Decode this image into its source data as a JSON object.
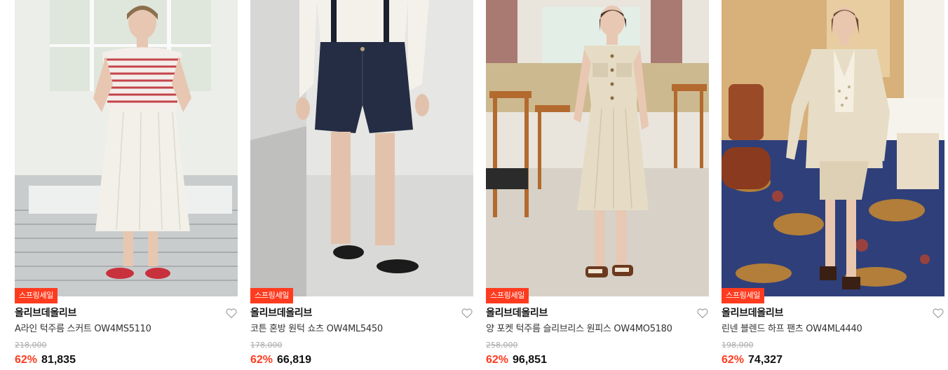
{
  "products": [
    {
      "badge": "스프링세일",
      "brand": "올리브데올리브",
      "name": "A라인 턱주름 스커트 OW4MS5110",
      "original_price": "218,000",
      "discount_rate": "62%",
      "sale_price": "81,835",
      "image_subject": "model-white-skirt-striped-top"
    },
    {
      "badge": "스프링세일",
      "brand": "올리브데올리브",
      "name": "코튼 혼방 원턱 쇼츠 OW4ML5450",
      "original_price": "178,000",
      "discount_rate": "62%",
      "sale_price": "66,819",
      "image_subject": "model-navy-shorts"
    },
    {
      "badge": "스프링세일",
      "brand": "올리브데올리브",
      "name": "양 포켓 턱주름 슬리브리스 원피스 OW4MO5180",
      "original_price": "258,000",
      "discount_rate": "62%",
      "sale_price": "96,851",
      "image_subject": "model-beige-sleeveless-dress"
    },
    {
      "badge": "스프링세일",
      "brand": "올리브데올리브",
      "name": "린넨 블렌드 하프 팬츠 OW4ML4440",
      "original_price": "198,000",
      "discount_rate": "62%",
      "sale_price": "74,327",
      "image_subject": "model-linen-jacket-half-pants"
    }
  ],
  "colors": {
    "accent": "#ff3b1f",
    "text": "#111111",
    "muted": "#aaaaaa",
    "heart": "#999999"
  },
  "icons": {
    "wishlist": "heart-outline-icon"
  }
}
